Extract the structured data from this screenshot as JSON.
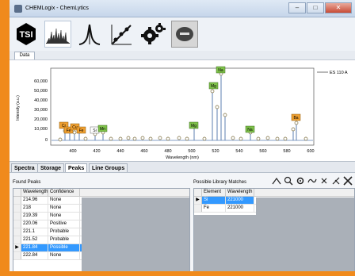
{
  "window": {
    "title": "CHEMLogix - ChemLytics"
  },
  "toolbar": {
    "buttons": [
      "logo",
      "spectrum",
      "peak",
      "calibration",
      "settings",
      "disk"
    ]
  },
  "plot": {
    "subtab": "Data",
    "legend": "ES 110 A",
    "ylabel": "Intensity (a.u.)",
    "xlabel": "Wavelength (nm)",
    "y_ticks": [
      "60,000",
      "50,000",
      "40,000",
      "30,000",
      "20,000",
      "10,000",
      "0"
    ],
    "x_ticks": [
      "400",
      "420",
      "440",
      "460",
      "480",
      "500",
      "520",
      "540",
      "560",
      "580",
      "600"
    ],
    "peak_labels": [
      {
        "text": "Cr",
        "kind": "orange"
      },
      {
        "text": "Fe",
        "kind": "orange"
      },
      {
        "text": "Cu",
        "kind": "orange"
      },
      {
        "text": "Fe",
        "kind": "orange"
      },
      {
        "text": "Si",
        "kind": "white"
      },
      {
        "text": "Mn",
        "kind": "green"
      },
      {
        "text": "Mg",
        "kind": "green"
      },
      {
        "text": "Na",
        "kind": "green"
      },
      {
        "text": "Mg",
        "kind": "green"
      },
      {
        "text": "Na",
        "kind": "green"
      },
      {
        "text": "Ba",
        "kind": "orange"
      }
    ]
  },
  "tabs": [
    "Spectra",
    "Storage",
    "Peaks",
    "Line Groups"
  ],
  "found_peaks": {
    "title": "Found Peaks",
    "columns": [
      "Wavelength",
      "Confidence"
    ],
    "rows": [
      [
        "214.96",
        "None"
      ],
      [
        "218",
        "None"
      ],
      [
        "219.39",
        "None"
      ],
      [
        "220.06",
        "Positive"
      ],
      [
        "221.1",
        "Probable"
      ],
      [
        "221.52",
        "Probable"
      ],
      [
        "221.84",
        "Possible"
      ],
      [
        "222.84",
        "None"
      ]
    ],
    "selected_marker": "▶"
  },
  "library_matches": {
    "title": "Possible Library Matches",
    "columns": [
      "Element",
      "Wavelength"
    ],
    "rows": [
      [
        "Si",
        "221000"
      ],
      [
        "Fe",
        "221000"
      ]
    ],
    "selected_marker": "▶"
  },
  "colors": {
    "orange": "#f08a1c",
    "selection": "#3399ff",
    "peak_label_green": "#7fc24a",
    "peak_label_orange": "#f0a030"
  }
}
